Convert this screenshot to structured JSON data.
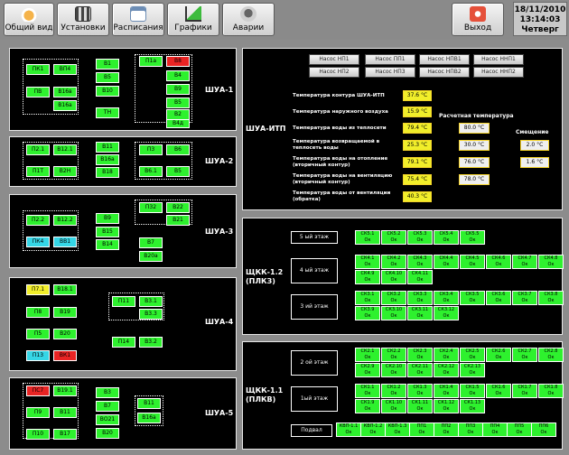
{
  "toolbar": {
    "buttons": [
      {
        "label": "Общий вид",
        "icon": "home-icon"
      },
      {
        "label": "Установки",
        "icon": "settings-grid-icon"
      },
      {
        "label": "Расписания",
        "icon": "calendar-icon"
      },
      {
        "label": "Графики",
        "icon": "chart-icon"
      },
      {
        "label": "Аварии",
        "icon": "alarm-bell-icon"
      }
    ],
    "exit_label": "Выход",
    "date": "18/11/2010",
    "time": "13:14:03",
    "weekday": "Четверг"
  },
  "colors": {
    "green": "#2ef12e",
    "cyan": "#35d6e6",
    "yellow": "#f1ee2a",
    "red": "#e92424"
  },
  "shua": {
    "shua1": {
      "title": "ШУА-1",
      "cells": [
        "ПК1",
        "ВП4",
        "ПВ",
        "В16в",
        "В16а",
        "В1",
        "В5",
        "В10",
        "ТН",
        "П1а",
        "В8",
        "В4",
        "В9",
        "В5",
        "В2",
        "В4д"
      ]
    },
    "shua2": {
      "title": "ШУА-2",
      "cells": [
        "П2.1",
        "В12.1",
        "П1Т",
        "В2Н",
        "В11",
        "В16а",
        "В18",
        "П3",
        "В6",
        "В6.1",
        "В5"
      ]
    },
    "shua3": {
      "title": "ШУА-3",
      "cells": [
        "П2.2",
        "В12.2",
        "ПК4",
        "ВВ1",
        "В9",
        "В15",
        "В14",
        "П32",
        "В22",
        "В21",
        "В7",
        "В20а"
      ]
    },
    "shua4": {
      "title": "ШУА-4",
      "cells": [
        "П7.1",
        "В18.1",
        "П8",
        "В19",
        "П5",
        "В20",
        "П13",
        "ВК1",
        "П11",
        "В3.1",
        "В3.3",
        "П14",
        "В3.2"
      ]
    },
    "shua5": {
      "title": "ШУА-5",
      "cells": [
        "ПС7",
        "В19.1",
        "П9",
        "В11",
        "П10",
        "В17",
        "В3",
        "В7",
        "ВО21",
        "В20",
        "В11",
        "В16а"
      ]
    }
  },
  "itp": {
    "title": "ШУА-ИТП",
    "pumps": [
      "Насос НП1",
      "Насос НП2",
      "Насос ПП1",
      "Насос НП3",
      "Насос НПВ1",
      "Насос НПВ2",
      "Насос ННП1",
      "Насос ННП2"
    ],
    "rows": [
      {
        "label": "Температура контура ШУА-ИТП",
        "value": "37.6 °C"
      },
      {
        "label": "Температура наружного воздуха",
        "value": "15.9 °C"
      },
      {
        "label": "Температура воды из теплосети",
        "value": "79.4 °C",
        "calc": "80.0 °C"
      },
      {
        "label": "Температура возвращаемой в теплосеть воды",
        "value": "25.3 °C",
        "calc": "30.0 °C",
        "diff": "2.0 °C"
      },
      {
        "label": "Температура воды на отопление (вторичный контур)",
        "value": "79.1 °C",
        "calc": "76.0 °C",
        "diff": "1.6 °C"
      },
      {
        "label": "Температура воды на вентиляцию (вторичный контур)",
        "value": "75.4 °C",
        "calc": "78.0 °C"
      },
      {
        "label": "Температура воды от вентиляции (обратка)",
        "value": "40.3 °C"
      }
    ],
    "calc_header": "Расчетная температура",
    "diff_header": "Смещение"
  },
  "shk12": {
    "title": "ЩКК-1.2",
    "subtitle": "(ПЛКЗ)",
    "floors": [
      "5 ый этаж",
      "4 ый этаж",
      "3 ий этаж"
    ],
    "floor5": [
      "СК5.1 Ок",
      "СК5.2 Ок",
      "СК5.3 Ок",
      "СК5.4 Ок",
      "СК5.5 Ок"
    ],
    "floor4": [
      "СК4.1 Ок",
      "СК4.2 Ок",
      "СК4.3 Ок",
      "СК4.4 Ок",
      "СК4.5 Ок",
      "СК4.6 Ок",
      "СК4.7 Ок",
      "СК4.8 Ок",
      "СК4.9 Ок",
      "СК4.10 Ок",
      "СК4.11 Ок"
    ],
    "floor3": [
      "СК3.1 Ок",
      "СК3.2 Ок",
      "СК3.3 Ок",
      "СК3.4 Ок",
      "СК3.5 Ок",
      "СК3.6 Ок",
      "СК3.7 Ок",
      "СК3.8 Ок",
      "СК3.9 Ок",
      "СК3.10 Ок",
      "СК3.11 Ок",
      "СК3.12 Ок"
    ]
  },
  "shk11": {
    "title": "ЩКК-1.1",
    "subtitle": "(ПЛКВ)",
    "floors": [
      "2 ой этаж",
      "1ый этаж",
      "Подвал"
    ],
    "floor2": [
      "СК2.1 Ок",
      "СК2.2 Ок",
      "СК2.3 Ок",
      "СК2.4 Ок",
      "СК2.5 Ок",
      "СК2.6 Ок",
      "СК2.7 Ок",
      "СК2.8 Ок",
      "СК2.9 Ок",
      "СК2.10 Ок",
      "СК2.11 Ок",
      "СК2.12 Ок",
      "СК2.13 Ок"
    ],
    "floor1": [
      "СК1.1 Ок",
      "СК1.2 Ок",
      "СК1.3 Ок",
      "СК1.4 Ок",
      "СК1.5 Ок",
      "СК1.6 Ок",
      "СК1.7 Ок",
      "СК1.8 Ок",
      "СК1.9 Ок",
      "СК1.10 Ок",
      "СК1.11 Ок",
      "СК1.12 Ок",
      "СК1.13 Ок"
    ],
    "basement": [
      "КВП-1.1 Ок",
      "КВП-1.2 Ок",
      "КВП-1.3 Ок",
      "ПП1 Ок",
      "ПП2 Ок",
      "ПП3 Ок",
      "ПП4 Ок",
      "ПП5 Ок",
      "ПП6 Ок"
    ]
  }
}
